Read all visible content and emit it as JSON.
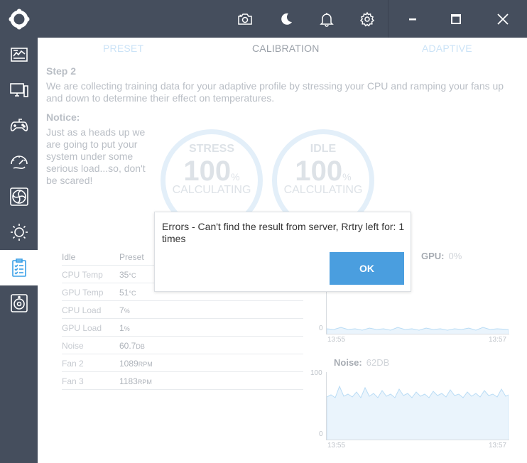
{
  "topbar": {
    "icons": [
      "camera-icon",
      "moon-icon",
      "bell-icon",
      "gear-icon",
      "minimize-icon",
      "maximize-icon",
      "close-icon"
    ]
  },
  "sidebar": {
    "icons": [
      "logo-icon",
      "dashboard-icon",
      "monitor-icon",
      "gamepad-icon",
      "gauge-icon",
      "fan-icon",
      "brightness-icon",
      "clipboard-icon",
      "speaker-icon"
    ],
    "active_index": 7
  },
  "tabs": {
    "preset": "PRESET",
    "calibration": "CALIBRATION",
    "adaptive": "ADAPTIVE"
  },
  "step": {
    "title": "Step 2",
    "description": "We are collecting training data for your adaptive profile by stressing your CPU and ramping your fans up and down to determine their effect on temperatures."
  },
  "notice": {
    "title": "Notice:",
    "text": "Just as a heads up we are going to put your system under some serious load...so, don't be scared!"
  },
  "rings": {
    "stress": {
      "label": "STRESS",
      "value": "100",
      "unit": "%",
      "status": "CALCULATING"
    },
    "idle": {
      "label": "IDLE",
      "value": "100",
      "unit": "%",
      "status": "CALCULATING"
    }
  },
  "idle_table": {
    "headers": [
      "Idle",
      "Preset"
    ],
    "rows": [
      {
        "label": "CPU Temp",
        "value": "35",
        "unit": "°C"
      },
      {
        "label": "GPU Temp",
        "value": "51",
        "unit": "°C"
      },
      {
        "label": "CPU Load",
        "value": "7",
        "unit": "%"
      },
      {
        "label": "GPU Load",
        "value": "1",
        "unit": "%"
      },
      {
        "label": "Noise",
        "value": "60.7",
        "unit": "DB"
      },
      {
        "label": "Fan 2",
        "value": "1089",
        "unit": "RPM"
      },
      {
        "label": "Fan 3",
        "value": "1183",
        "unit": "RPM"
      }
    ]
  },
  "gpu_chart": {
    "label": "GPU:",
    "value": "0%",
    "y_min": "0",
    "x_start": "13:55",
    "x_end": "13:57"
  },
  "noise_chart": {
    "label": "Noise:",
    "value": "62DB",
    "y_max": "100",
    "y_min": "0",
    "x_start": "13:55",
    "x_end": "13:57"
  },
  "dialog": {
    "message": "Errors - Can't find the result from server, Rrtry left for: 1 times",
    "ok_label": "OK"
  },
  "colors": {
    "sidebar_bg": "#454e5d",
    "accent": "#4a9edf",
    "ring": "#e3eff9"
  }
}
